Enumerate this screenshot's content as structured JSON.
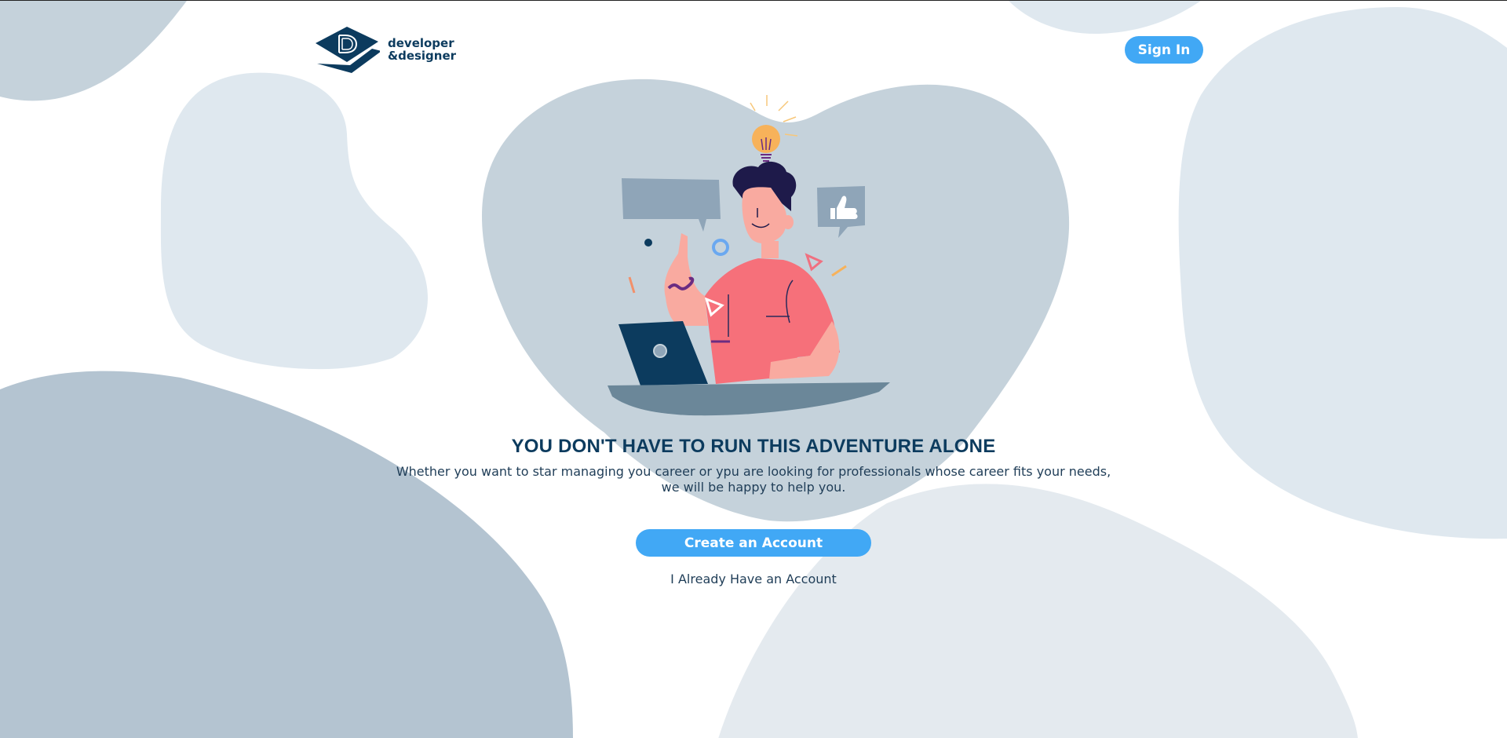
{
  "header": {
    "logo_line1": "developer",
    "logo_line2": "&designer",
    "signin_label": "Sign In"
  },
  "hero": {
    "headline": "YOU DON'T HAVE TO RUN THIS ADVENTURE ALONE",
    "subtext_line1": "Whether you want to star managing you career or ypu are looking for professionals whose career fits your needs,",
    "subtext_line2": "we will be happy to help you."
  },
  "actions": {
    "create_label": "Create an Account",
    "already_label": "I Already Have an Account"
  },
  "colors": {
    "primary_navy": "#0c3b5e",
    "accent_blue": "#41a8f5",
    "blob_light": "#dfe8ef",
    "blob_mid": "#c5d2db",
    "blob_dark": "#b4c4d1"
  },
  "icons": [
    "logo-mark-icon",
    "lightbulb-icon",
    "thumbs-up-icon",
    "speech-bubble-icon",
    "laptop-icon"
  ]
}
